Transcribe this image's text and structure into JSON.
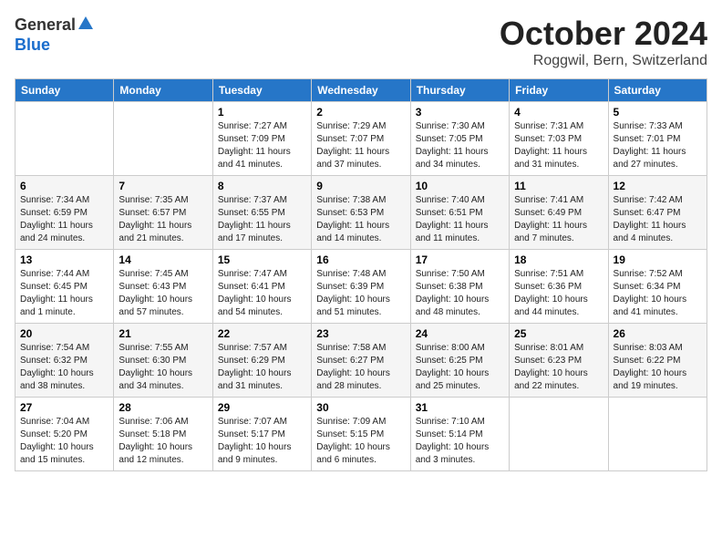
{
  "logo": {
    "general": "General",
    "blue": "Blue"
  },
  "header": {
    "month": "October 2024",
    "location": "Roggwil, Bern, Switzerland"
  },
  "weekdays": [
    "Sunday",
    "Monday",
    "Tuesday",
    "Wednesday",
    "Thursday",
    "Friday",
    "Saturday"
  ],
  "weeks": [
    [
      {
        "day": null,
        "data": null
      },
      {
        "day": null,
        "data": null
      },
      {
        "day": "1",
        "data": "Sunrise: 7:27 AM\nSunset: 7:09 PM\nDaylight: 11 hours and 41 minutes."
      },
      {
        "day": "2",
        "data": "Sunrise: 7:29 AM\nSunset: 7:07 PM\nDaylight: 11 hours and 37 minutes."
      },
      {
        "day": "3",
        "data": "Sunrise: 7:30 AM\nSunset: 7:05 PM\nDaylight: 11 hours and 34 minutes."
      },
      {
        "day": "4",
        "data": "Sunrise: 7:31 AM\nSunset: 7:03 PM\nDaylight: 11 hours and 31 minutes."
      },
      {
        "day": "5",
        "data": "Sunrise: 7:33 AM\nSunset: 7:01 PM\nDaylight: 11 hours and 27 minutes."
      }
    ],
    [
      {
        "day": "6",
        "data": "Sunrise: 7:34 AM\nSunset: 6:59 PM\nDaylight: 11 hours and 24 minutes."
      },
      {
        "day": "7",
        "data": "Sunrise: 7:35 AM\nSunset: 6:57 PM\nDaylight: 11 hours and 21 minutes."
      },
      {
        "day": "8",
        "data": "Sunrise: 7:37 AM\nSunset: 6:55 PM\nDaylight: 11 hours and 17 minutes."
      },
      {
        "day": "9",
        "data": "Sunrise: 7:38 AM\nSunset: 6:53 PM\nDaylight: 11 hours and 14 minutes."
      },
      {
        "day": "10",
        "data": "Sunrise: 7:40 AM\nSunset: 6:51 PM\nDaylight: 11 hours and 11 minutes."
      },
      {
        "day": "11",
        "data": "Sunrise: 7:41 AM\nSunset: 6:49 PM\nDaylight: 11 hours and 7 minutes."
      },
      {
        "day": "12",
        "data": "Sunrise: 7:42 AM\nSunset: 6:47 PM\nDaylight: 11 hours and 4 minutes."
      }
    ],
    [
      {
        "day": "13",
        "data": "Sunrise: 7:44 AM\nSunset: 6:45 PM\nDaylight: 11 hours and 1 minute."
      },
      {
        "day": "14",
        "data": "Sunrise: 7:45 AM\nSunset: 6:43 PM\nDaylight: 10 hours and 57 minutes."
      },
      {
        "day": "15",
        "data": "Sunrise: 7:47 AM\nSunset: 6:41 PM\nDaylight: 10 hours and 54 minutes."
      },
      {
        "day": "16",
        "data": "Sunrise: 7:48 AM\nSunset: 6:39 PM\nDaylight: 10 hours and 51 minutes."
      },
      {
        "day": "17",
        "data": "Sunrise: 7:50 AM\nSunset: 6:38 PM\nDaylight: 10 hours and 48 minutes."
      },
      {
        "day": "18",
        "data": "Sunrise: 7:51 AM\nSunset: 6:36 PM\nDaylight: 10 hours and 44 minutes."
      },
      {
        "day": "19",
        "data": "Sunrise: 7:52 AM\nSunset: 6:34 PM\nDaylight: 10 hours and 41 minutes."
      }
    ],
    [
      {
        "day": "20",
        "data": "Sunrise: 7:54 AM\nSunset: 6:32 PM\nDaylight: 10 hours and 38 minutes."
      },
      {
        "day": "21",
        "data": "Sunrise: 7:55 AM\nSunset: 6:30 PM\nDaylight: 10 hours and 34 minutes."
      },
      {
        "day": "22",
        "data": "Sunrise: 7:57 AM\nSunset: 6:29 PM\nDaylight: 10 hours and 31 minutes."
      },
      {
        "day": "23",
        "data": "Sunrise: 7:58 AM\nSunset: 6:27 PM\nDaylight: 10 hours and 28 minutes."
      },
      {
        "day": "24",
        "data": "Sunrise: 8:00 AM\nSunset: 6:25 PM\nDaylight: 10 hours and 25 minutes."
      },
      {
        "day": "25",
        "data": "Sunrise: 8:01 AM\nSunset: 6:23 PM\nDaylight: 10 hours and 22 minutes."
      },
      {
        "day": "26",
        "data": "Sunrise: 8:03 AM\nSunset: 6:22 PM\nDaylight: 10 hours and 19 minutes."
      }
    ],
    [
      {
        "day": "27",
        "data": "Sunrise: 7:04 AM\nSunset: 5:20 PM\nDaylight: 10 hours and 15 minutes."
      },
      {
        "day": "28",
        "data": "Sunrise: 7:06 AM\nSunset: 5:18 PM\nDaylight: 10 hours and 12 minutes."
      },
      {
        "day": "29",
        "data": "Sunrise: 7:07 AM\nSunset: 5:17 PM\nDaylight: 10 hours and 9 minutes."
      },
      {
        "day": "30",
        "data": "Sunrise: 7:09 AM\nSunset: 5:15 PM\nDaylight: 10 hours and 6 minutes."
      },
      {
        "day": "31",
        "data": "Sunrise: 7:10 AM\nSunset: 5:14 PM\nDaylight: 10 hours and 3 minutes."
      },
      {
        "day": null,
        "data": null
      },
      {
        "day": null,
        "data": null
      }
    ]
  ]
}
